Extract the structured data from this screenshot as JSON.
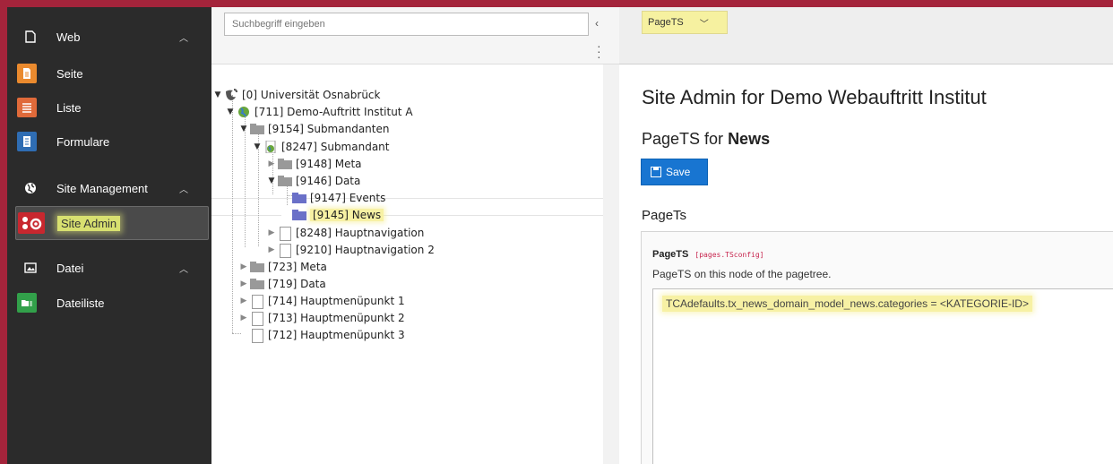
{
  "sidebar": {
    "groups": [
      {
        "label": "Web",
        "icon": "page-outline-icon"
      },
      {
        "label": "Site Management",
        "icon": "globe-icon"
      },
      {
        "label": "Datei",
        "icon": "image-icon"
      }
    ],
    "items": [
      {
        "label": "Seite",
        "icon": "page-icon",
        "color": "#ea8a2e"
      },
      {
        "label": "Liste",
        "icon": "list-icon",
        "color": "#e06a3a"
      },
      {
        "label": "Formulare",
        "icon": "form-icon",
        "color": "#2f6db3"
      },
      {
        "label": "Site Admin",
        "icon": "site-admin-icon",
        "color": "#c8272f"
      },
      {
        "label": "Dateiliste",
        "icon": "filelist-icon",
        "color": "#32a04a"
      }
    ]
  },
  "tree": {
    "search_placeholder": "Suchbegriff eingeben",
    "nodes": [
      {
        "label": "[0] Universität Osnabrück"
      },
      {
        "label": "[711] Demo-Auftritt Institut A"
      },
      {
        "label": "[9154] Submandanten"
      },
      {
        "label": "[8247] Submandant"
      },
      {
        "label": "[9148] Meta"
      },
      {
        "label": "[9146] Data"
      },
      {
        "label": "[9147] Events"
      },
      {
        "label": "[9145] News"
      },
      {
        "label": "[8248] Hauptnavigation"
      },
      {
        "label": "[9210] Hauptnavigation 2"
      },
      {
        "label": "[723] Meta"
      },
      {
        "label": "[719] Data"
      },
      {
        "label": "[714] Hauptmenüpunkt 1"
      },
      {
        "label": "[713] Hauptmenüpunkt 2"
      },
      {
        "label": "[712] Hauptmenüpunkt 3"
      }
    ]
  },
  "docheader": {
    "module_select": "PageTS"
  },
  "main": {
    "title": "Site Admin for Demo Webauftritt Institut",
    "subtitle_prefix": "PageTS for",
    "subtitle_page": "News",
    "save_label": "Save",
    "section_title": "PageTs",
    "field": {
      "label": "PageTS",
      "key": "[pages.TSconfig]",
      "description": "PageTS on this node of the pagetree.",
      "value": "TCAdefaults.tx_news_domain_model_news.categories = <KATEGORIE-ID>"
    }
  },
  "colors": {
    "frame": "#a4243b",
    "sidebar_bg": "#2b2b2b",
    "highlight": "#f7f1a4",
    "primary_button": "#1875d1"
  }
}
